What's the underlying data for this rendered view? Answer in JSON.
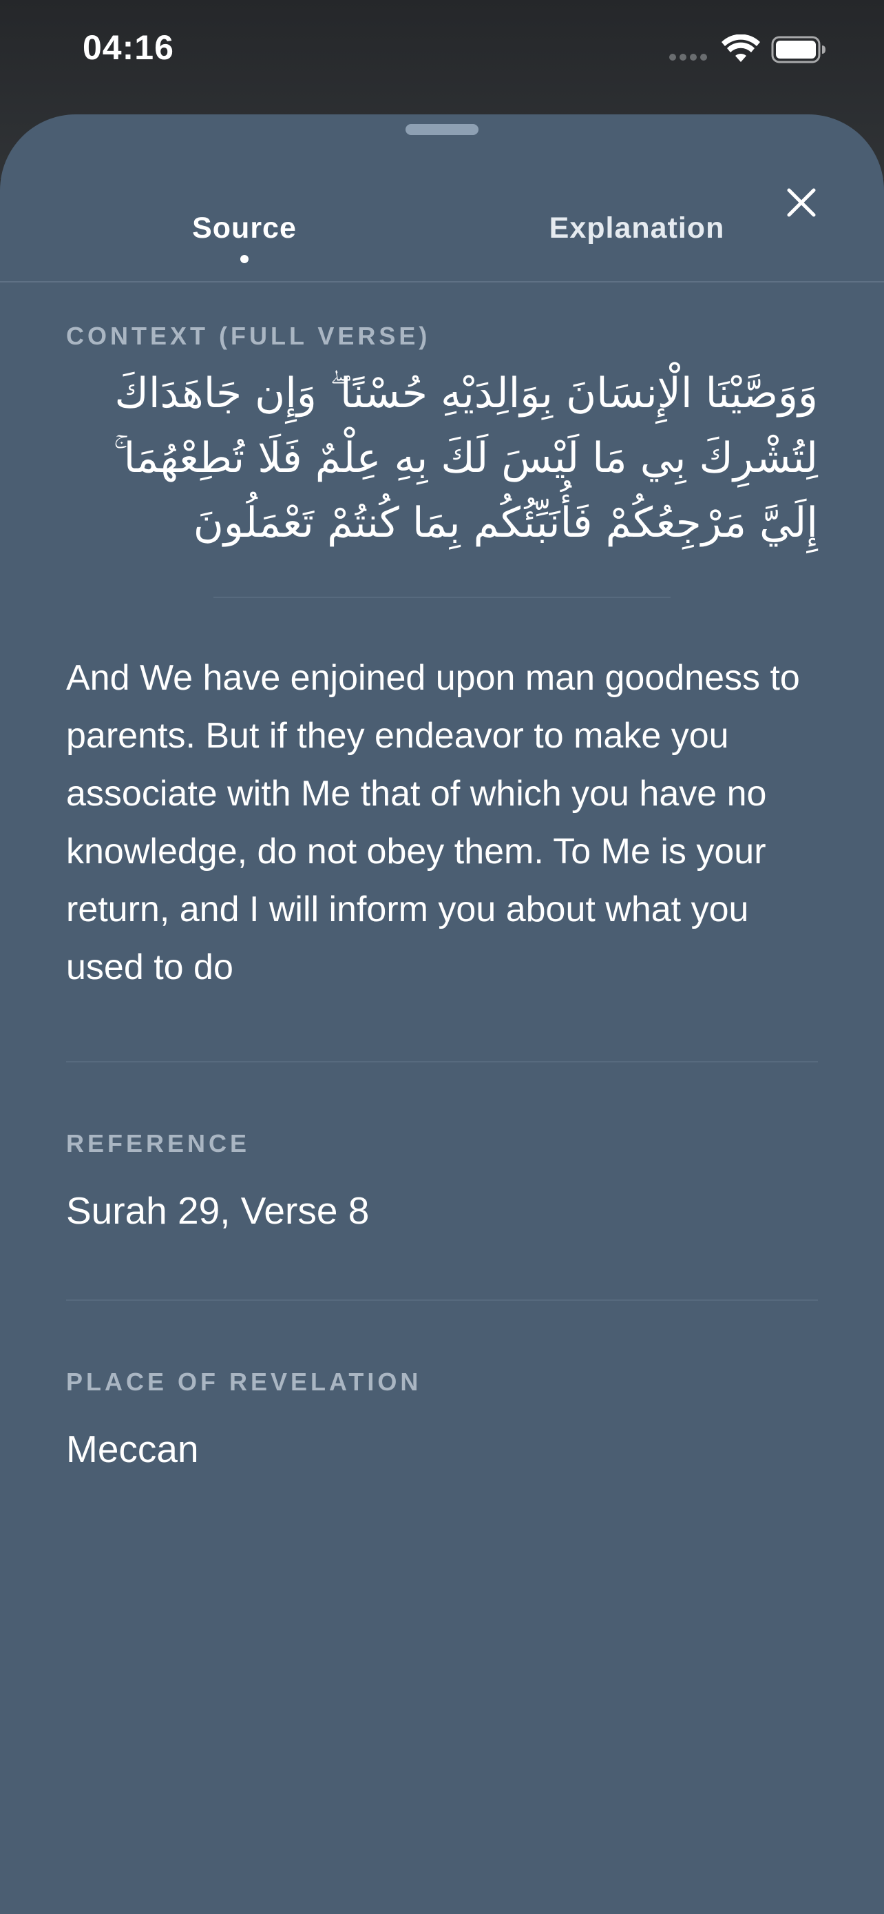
{
  "status_bar": {
    "time": "04:16"
  },
  "tabs": [
    {
      "label": "Source",
      "active": true
    },
    {
      "label": "Explanation",
      "active": false
    }
  ],
  "context": {
    "label": "CONTEXT (FULL VERSE)",
    "arabic": "وَوَصَّيْنَا الْإِنسَانَ بِوَالِدَيْهِ حُسْنًا ۖ وَإِن جَاهَدَاكَ لِتُشْرِكَ بِي مَا لَيْسَ لَكَ بِهِ عِلْمٌ فَلَا تُطِعْهُمَا ۚ إِلَيَّ مَرْجِعُكُمْ فَأُنَبِّئُكُم بِمَا كُنتُمْ تَعْمَلُونَ",
    "translation": "And We have enjoined upon man goodness to parents. But if they endeavor to make you associate with Me that of which you have no knowledge, do not obey them. To Me is your return, and I will inform you about what you used to do"
  },
  "reference": {
    "label": "REFERENCE",
    "value": "Surah 29, Verse 8"
  },
  "revelation": {
    "label": "PLACE OF REVELATION",
    "value": "Meccan"
  },
  "icons": {
    "close": "close-icon",
    "wifi": "wifi-icon",
    "battery": "battery-icon"
  },
  "colors": {
    "sheet_background": "#4b5e72",
    "section_label": "#aab6c3",
    "divider": "#576a7e"
  }
}
